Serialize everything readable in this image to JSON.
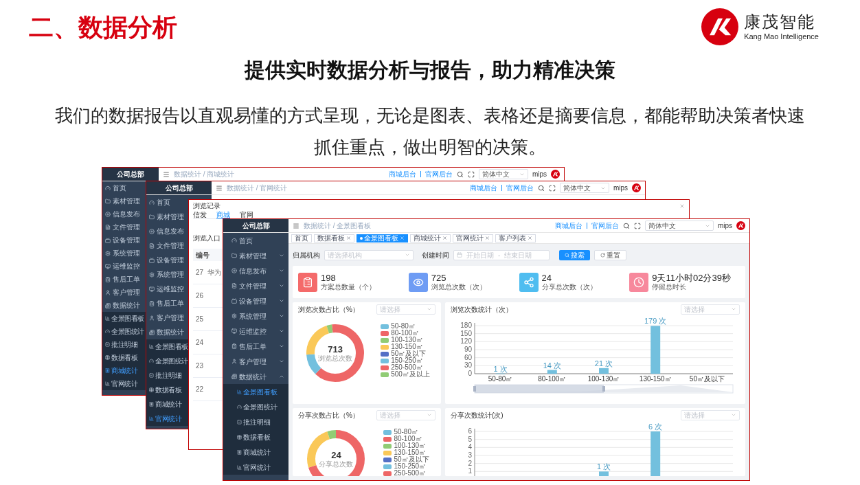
{
  "slide": {
    "section_title": "二、数据分析",
    "brand": {
      "name": "康茂智能",
      "tagline": "Kang Mao Intelligence"
    },
    "heading": "提供实时数据分析与报告，助力精准决策",
    "paragraph": "我们的数据报告以直观易懂的方式呈现，无论是图表、表格还是摘要信息，都能帮助决策者快速抓住重点，做出明智的决策。"
  },
  "back_windows": [
    {
      "header": {
        "breadcrumb": "数据统计 / 商城统计",
        "links": [
          "商城后台",
          "官网后台"
        ],
        "language": "简体中文",
        "user": "mips"
      },
      "sidebar": {
        "title": "公司总部",
        "items": [
          {
            "label": "首页"
          },
          {
            "label": "素材管理"
          },
          {
            "label": "信息发布"
          },
          {
            "label": "文件管理"
          },
          {
            "label": "设备管理"
          },
          {
            "label": "系统管理"
          },
          {
            "label": "运维监控"
          },
          {
            "label": "售后工单"
          },
          {
            "label": "客户管理"
          },
          {
            "label": "数据统计",
            "children": [
              {
                "label": "全景图看板",
                "selected": false
              },
              {
                "label": "全景图统计",
                "selected": false
              },
              {
                "label": "批注明细",
                "selected": false
              },
              {
                "label": "数据看板",
                "selected": false
              },
              {
                "label": "商城统计",
                "selected": true
              },
              {
                "label": "官网统计",
                "selected": false
              }
            ]
          }
        ]
      }
    },
    {
      "header": {
        "breadcrumb": "数据统计 / 官网统计",
        "links": [
          "商城后台",
          "官网后台"
        ],
        "language": "简体中文",
        "user": "mips"
      },
      "sidebar": {
        "title": "公司总部",
        "items": [
          {
            "label": "首页"
          },
          {
            "label": "素材管理"
          },
          {
            "label": "信息发布"
          },
          {
            "label": "文件管理"
          },
          {
            "label": "设备管理"
          },
          {
            "label": "系统管理"
          },
          {
            "label": "运维监控"
          },
          {
            "label": "售后工单"
          },
          {
            "label": "客户管理"
          },
          {
            "label": "数据统计",
            "children": [
              {
                "label": "全景图看板",
                "selected": false
              },
              {
                "label": "全景图统计",
                "selected": false
              },
              {
                "label": "批注明细",
                "selected": false
              },
              {
                "label": "数据看板",
                "selected": false
              },
              {
                "label": "商城统计",
                "selected": false
              },
              {
                "label": "官网统计",
                "selected": true
              }
            ]
          }
        ]
      }
    }
  ],
  "dialog": {
    "title": "浏览记录",
    "tabs": [
      {
        "label": "信发",
        "selected": false
      },
      {
        "label": "商城",
        "selected": true
      },
      {
        "label": "官网",
        "selected": false
      }
    ],
    "filter_label": "浏览入口",
    "table": {
      "columns": [
        "编号"
      ],
      "rows": [
        {
          "id": "27",
          "name": "华为"
        },
        {
          "id": "26"
        },
        {
          "id": "25"
        },
        {
          "id": "24"
        },
        {
          "id": "23"
        },
        {
          "id": "22"
        }
      ]
    }
  },
  "front_window": {
    "header": {
      "breadcrumb": "数据统计 / 全景图看板",
      "links": [
        "商城后台",
        "官网后台"
      ],
      "language": "简体中文",
      "user": "mips"
    },
    "sidebar": {
      "title": "公司总部",
      "items": [
        {
          "label": "首页"
        },
        {
          "label": "素材管理",
          "expanded": false
        },
        {
          "label": "信息发布",
          "expanded": false
        },
        {
          "label": "文件管理",
          "expanded": false
        },
        {
          "label": "设备管理",
          "expanded": false
        },
        {
          "label": "系统管理",
          "expanded": false
        },
        {
          "label": "运维监控",
          "expanded": false
        },
        {
          "label": "售后工单",
          "expanded": false
        },
        {
          "label": "客户管理",
          "expanded": false
        },
        {
          "label": "数据统计",
          "expanded": true,
          "children": [
            {
              "label": "全景图看板",
              "selected": true
            },
            {
              "label": "全景图统计",
              "selected": false
            },
            {
              "label": "批注明细",
              "selected": false
            },
            {
              "label": "数据看板",
              "selected": false
            },
            {
              "label": "商城统计",
              "selected": false
            },
            {
              "label": "官网统计",
              "selected": false
            }
          ]
        }
      ]
    },
    "tabs": [
      {
        "label": "首页",
        "selected": false,
        "closable": false
      },
      {
        "label": "数据看板",
        "selected": false,
        "closable": true
      },
      {
        "label": "全景图看板",
        "selected": true,
        "closable": true
      },
      {
        "label": "商城统计",
        "selected": false,
        "closable": true
      },
      {
        "label": "官网统计",
        "selected": false,
        "closable": true
      },
      {
        "label": "客户列表",
        "selected": false,
        "closable": true
      }
    ],
    "filters": {
      "org_label": "归属机构",
      "org_placeholder": "请选择机构",
      "date_label": "创建时间",
      "start_placeholder": "开始日期",
      "range_separator": "-",
      "end_placeholder": "结束日期",
      "buttons": [
        {
          "label": "搜索",
          "kind": "primary"
        },
        {
          "label": "重置",
          "kind": "default"
        }
      ]
    },
    "stats": [
      {
        "value": "198",
        "label": "方案总数量（个）"
      },
      {
        "value": "725",
        "label": "浏览总次数（次）"
      },
      {
        "value": "24",
        "label": "分享总次数（次）"
      },
      {
        "value": "9天11小时02分39秒",
        "label": "停留总时长"
      }
    ],
    "charts": [
      {
        "kind": "donut",
        "title": "浏览次数占比（%）",
        "select_placeholder": "请选择",
        "total": "713",
        "total_label": "浏览总次数",
        "legend": [
          {
            "label": "50-80㎡",
            "color": "#73c0de"
          },
          {
            "label": "80-100㎡",
            "color": "#ee6666"
          },
          {
            "label": "100-130㎡",
            "color": "#91cc75"
          },
          {
            "label": "130-150㎡",
            "color": "#fac858"
          },
          {
            "label": "50㎡及以下",
            "color": "#5470c6"
          },
          {
            "label": "150-250㎡",
            "color": "#73c0de"
          },
          {
            "label": "250-500㎡",
            "color": "#ee6666"
          },
          {
            "label": "500㎡及以上",
            "color": "#91cc75"
          }
        ]
      },
      {
        "kind": "bar",
        "title": "浏览次数统计（次）",
        "select_placeholder": "请选择",
        "range_slider": true,
        "chart_data": {
          "type": "bar",
          "categories": [
            "50-80㎡",
            "80-100㎡",
            "100-130㎡",
            "130-150㎡",
            "50㎡及以下"
          ],
          "values": [
            1,
            14,
            21,
            179,
            null
          ],
          "ylim": [
            0,
            180
          ],
          "grid": true,
          "yticks": [
            0,
            30,
            60,
            90,
            120,
            150,
            180
          ],
          "value_labels": [
            "1 次",
            "14 次",
            "21 次",
            "179 次",
            null
          ]
        }
      },
      {
        "kind": "donut",
        "title": "分享次数占比（%）",
        "select_placeholder": "请选择",
        "total": "24",
        "total_label": "分享总次数",
        "legend": [
          {
            "label": "50-80㎡",
            "color": "#73c0de"
          },
          {
            "label": "80-100㎡",
            "color": "#ee6666"
          },
          {
            "label": "100-130㎡",
            "color": "#91cc75"
          },
          {
            "label": "130-150㎡",
            "color": "#fac858"
          },
          {
            "label": "50㎡及以下",
            "color": "#5470c6"
          },
          {
            "label": "150-250㎡",
            "color": "#73c0de"
          },
          {
            "label": "250-500㎡",
            "color": "#ee6666"
          }
        ]
      },
      {
        "kind": "bar",
        "title": "分享次数统计(次)",
        "select_placeholder": "请选择",
        "range_slider": false,
        "chart_data": {
          "type": "bar",
          "values": [
            null,
            null,
            1,
            6,
            null
          ],
          "ylim": [
            0,
            6
          ],
          "grid": true,
          "yticks": [
            1,
            2,
            3,
            4,
            5,
            6
          ],
          "value_labels": [
            null,
            null,
            "1 次",
            "6 次",
            null
          ]
        }
      }
    ]
  }
}
